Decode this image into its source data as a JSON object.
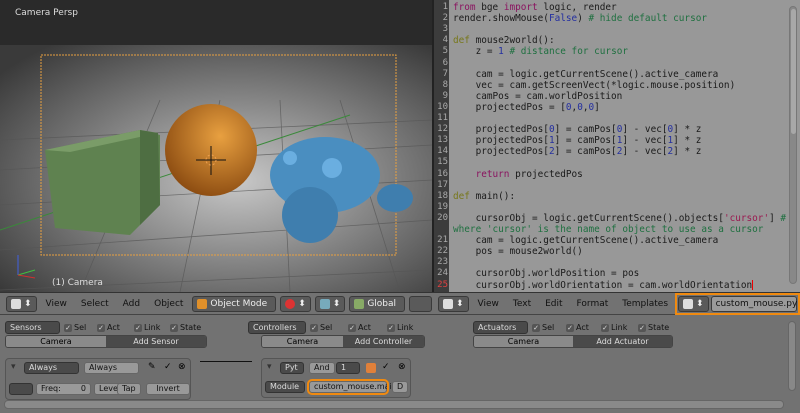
{
  "viewport": {
    "view_label": "Camera Persp",
    "object_label": "(1) Camera"
  },
  "viewport_header": {
    "menu": [
      "View",
      "Select",
      "Add",
      "Object"
    ],
    "mode": "Object Mode",
    "orientation": "Global"
  },
  "text_editor": {
    "menu": [
      "View",
      "Text",
      "Edit",
      "Format",
      "Templates"
    ],
    "filename": "custom_mouse.py",
    "current_line": 25,
    "lines": [
      {
        "n": "1",
        "t": [
          [
            "from",
            "k"
          ],
          " bge ",
          [
            "import",
            "k"
          ],
          " logic, render"
        ]
      },
      {
        "n": "2",
        "t": [
          "render.showMouse(",
          [
            "False",
            "n"
          ],
          ") ",
          [
            "# hide default cursor",
            "c"
          ]
        ]
      },
      {
        "n": "3",
        "t": []
      },
      {
        "n": "4",
        "t": [
          [
            "def",
            "d"
          ],
          " mouse2world():"
        ]
      },
      {
        "n": "5",
        "t": [
          "    z = ",
          [
            "1",
            "n"
          ],
          " ",
          [
            "# distance for cursor",
            "c"
          ]
        ]
      },
      {
        "n": "6",
        "t": []
      },
      {
        "n": "7",
        "t": [
          "    cam = logic.getCurrentScene().active_camera"
        ]
      },
      {
        "n": "8",
        "t": [
          "    vec = cam.getScreenVect(*logic.mouse.position)"
        ]
      },
      {
        "n": "9",
        "t": [
          "    camPos = cam.worldPosition"
        ]
      },
      {
        "n": "10",
        "t": [
          "    projectedPos = [",
          [
            "0",
            "n"
          ],
          ",",
          [
            "0",
            "n"
          ],
          ",",
          [
            "0",
            "n"
          ],
          "]"
        ]
      },
      {
        "n": "11",
        "t": []
      },
      {
        "n": "12",
        "t": [
          "    projectedPos[",
          [
            "0",
            "n"
          ],
          "] = camPos[",
          [
            "0",
            "n"
          ],
          "] - vec[",
          [
            "0",
            "n"
          ],
          "] * z"
        ]
      },
      {
        "n": "13",
        "t": [
          "    projectedPos[",
          [
            "1",
            "n"
          ],
          "] = camPos[",
          [
            "1",
            "n"
          ],
          "] - vec[",
          [
            "1",
            "n"
          ],
          "] * z"
        ]
      },
      {
        "n": "14",
        "t": [
          "    projectedPos[",
          [
            "2",
            "n"
          ],
          "] = camPos[",
          [
            "2",
            "n"
          ],
          "] - vec[",
          [
            "2",
            "n"
          ],
          "] * z"
        ]
      },
      {
        "n": "15",
        "t": []
      },
      {
        "n": "16",
        "t": [
          "    ",
          [
            "return",
            "k"
          ],
          " projectedPos"
        ]
      },
      {
        "n": "17",
        "t": []
      },
      {
        "n": "18",
        "t": [
          [
            "def",
            "d"
          ],
          " main():"
        ]
      },
      {
        "n": "19",
        "t": []
      },
      {
        "n": "20",
        "t": [
          "    cursorObj = logic.getCurrentScene().objects[",
          [
            "'cursor'",
            "s"
          ],
          "] ",
          [
            "#",
            "c"
          ]
        ]
      },
      {
        "n": "",
        "t": [
          [
            "where 'cursor' is the name of object to use as a cursor",
            "c"
          ]
        ]
      },
      {
        "n": "21",
        "t": [
          "    cam = logic.getCurrentScene().active_camera"
        ]
      },
      {
        "n": "22",
        "t": [
          "    pos = mouse2world()"
        ]
      },
      {
        "n": "23",
        "t": []
      },
      {
        "n": "24",
        "t": [
          "    cursorObj.worldPosition = pos"
        ]
      },
      {
        "n": "25",
        "t": [
          "    cursorObj.worldOrientation = cam.worldOrientation"
        ]
      }
    ]
  },
  "logic": {
    "sensors": {
      "dropdown": "Sensors",
      "checks": [
        "Sel",
        "Act",
        "Link",
        "State"
      ],
      "object": "Camera",
      "add": "Add Sensor",
      "brick": {
        "type": "Always",
        "name": "Always",
        "freq_label": "Freq:",
        "freq_value": "0",
        "level": "Level",
        "tap": "Tap",
        "invert": "Invert"
      }
    },
    "controllers": {
      "dropdown": "Controllers",
      "checks": [
        "Sel",
        "Act",
        "Link"
      ],
      "object": "Camera",
      "add": "Add Controller",
      "brick": {
        "type": "Pyt",
        "name": "And",
        "state": "1",
        "mode": "Module",
        "module": "custom_mouse.main",
        "debug": "D"
      }
    },
    "actuators": {
      "dropdown": "Actuators",
      "checks": [
        "Sel",
        "Act",
        "Link",
        "State"
      ],
      "object": "Camera",
      "add": "Add Actuator"
    }
  },
  "colors": {
    "highlight": "#f08a10",
    "cube": "#6b8f5a",
    "sphere": "#d98a2a",
    "monkey": "#4a8ec0"
  }
}
